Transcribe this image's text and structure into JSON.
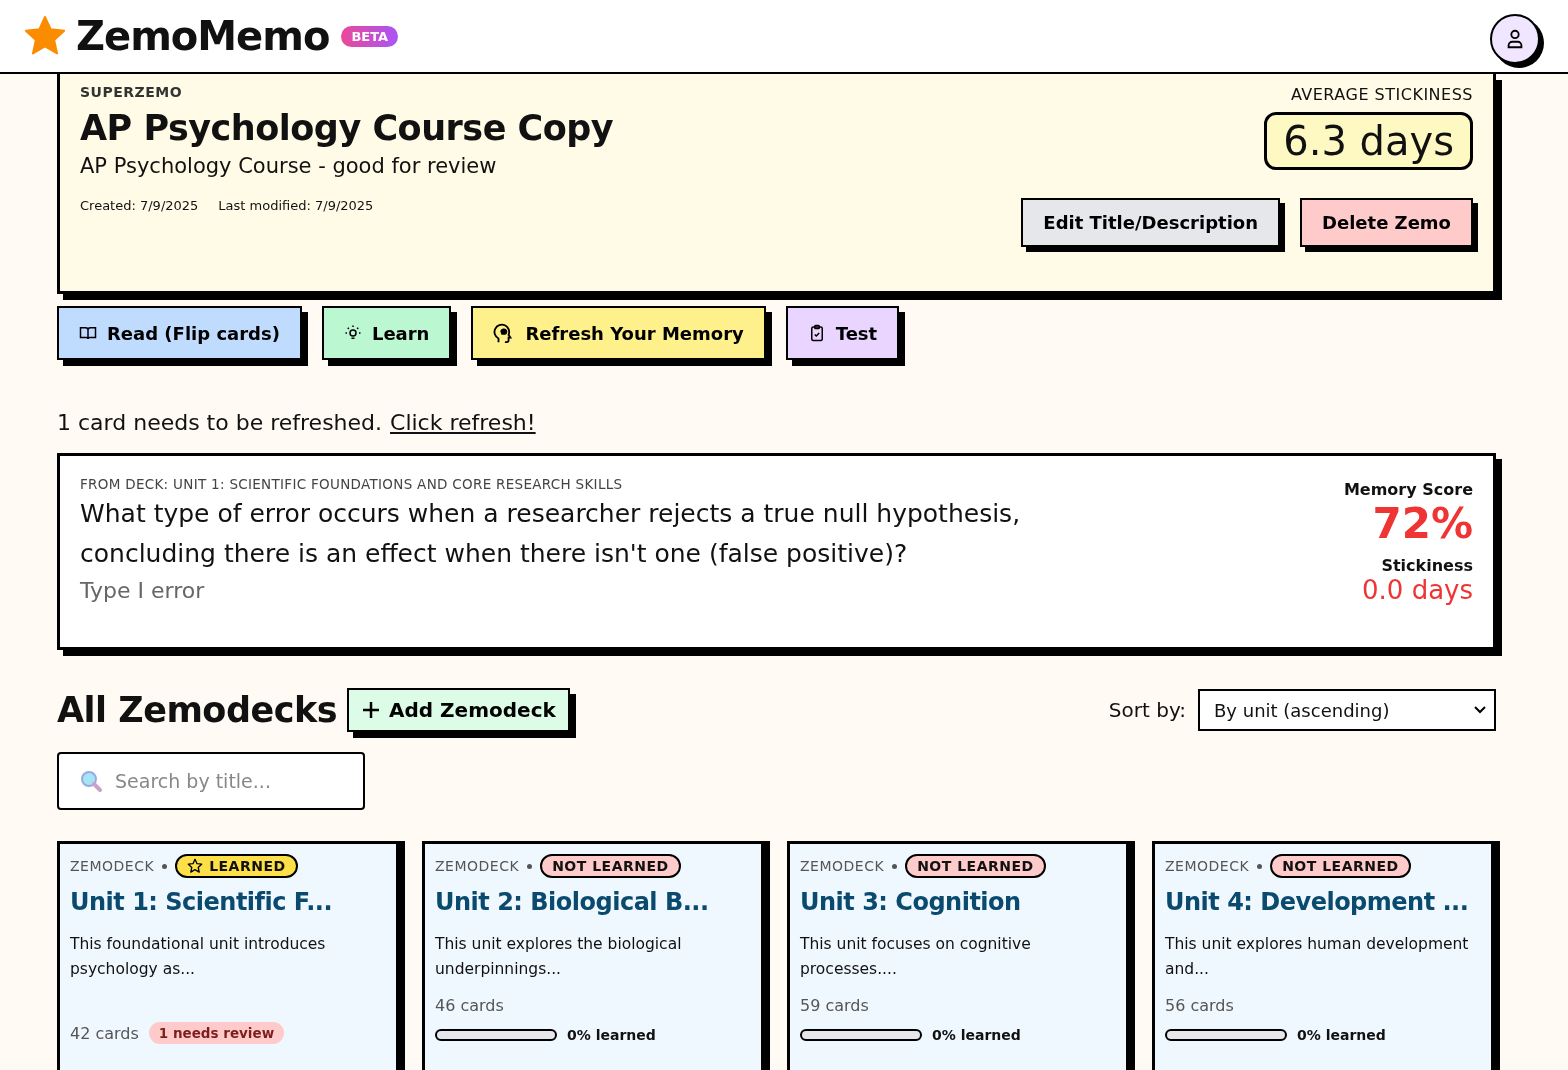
{
  "app": {
    "name": "ZemoMemo",
    "badge": "BETA"
  },
  "zemo": {
    "eyebrow": "SUPERZEMO",
    "title": "AP Psychology Course Copy",
    "description": "AP Psychology Course - good for review",
    "created": "Created: 7/9/2025",
    "modified": "Last modified: 7/9/2025",
    "stickiness_label": "AVERAGE STICKINESS",
    "stickiness": "6.3 days",
    "buttons": [
      "Edit Title/Description",
      "Delete Zemo"
    ]
  },
  "modes": [
    "Read (Flip cards)",
    "Learn",
    "Refresh Your Memory",
    "Test"
  ],
  "refresh": {
    "message": "1 card needs to be refreshed.",
    "link": "Click refresh!"
  },
  "due_card": {
    "deck": "FROM DECK: UNIT 1: SCIENTIFIC FOUNDATIONS AND CORE RESEARCH SKILLS",
    "question": "What type of error occurs when a researcher rejects a true null hypothesis, concluding there is an effect when there isn't one (false positive)?",
    "answer": "Type I error",
    "memory_label": "Memory Score",
    "memory": "72%",
    "stickiness_label": "Stickiness",
    "stickiness": "0.0 days"
  },
  "decks_section": {
    "title": "All Zemodecks",
    "add_button": "Add Zemodeck",
    "sort_label": "Sort by:",
    "sort_value": "By unit (ascending)",
    "search": {
      "placeholder": "Search by title..."
    }
  },
  "decks": [
    {
      "kind": "deck",
      "label": "ZEMODECK",
      "learned": true,
      "status": "LEARNED",
      "title": "Unit 1: Scientific F...",
      "description": "This foundational unit introduces psychology as...",
      "cards": "42 cards",
      "review": "1 needs review"
    },
    {
      "kind": "deck",
      "label": "ZEMODECK",
      "learned": false,
      "status": "NOT LEARNED",
      "title": "Unit 2: Biological B...",
      "description": "This unit explores the biological underpinnings...",
      "cards": "46 cards",
      "level": 0,
      "progress": "0% learned"
    },
    {
      "kind": "deck",
      "label": "ZEMODECK",
      "learned": false,
      "status": "NOT LEARNED",
      "title": "Unit 3: Cognition",
      "description": "This unit focuses on cognitive processes....",
      "cards": "59 cards",
      "level": 0,
      "progress": "0% learned"
    },
    {
      "kind": "deck",
      "label": "ZEMODECK",
      "learned": false,
      "status": "NOT LEARNED",
      "title": "Unit 4: Development ...",
      "description": "This unit explores human development and...",
      "cards": "56 cards",
      "level": 0,
      "progress": "0% learned"
    }
  ]
}
